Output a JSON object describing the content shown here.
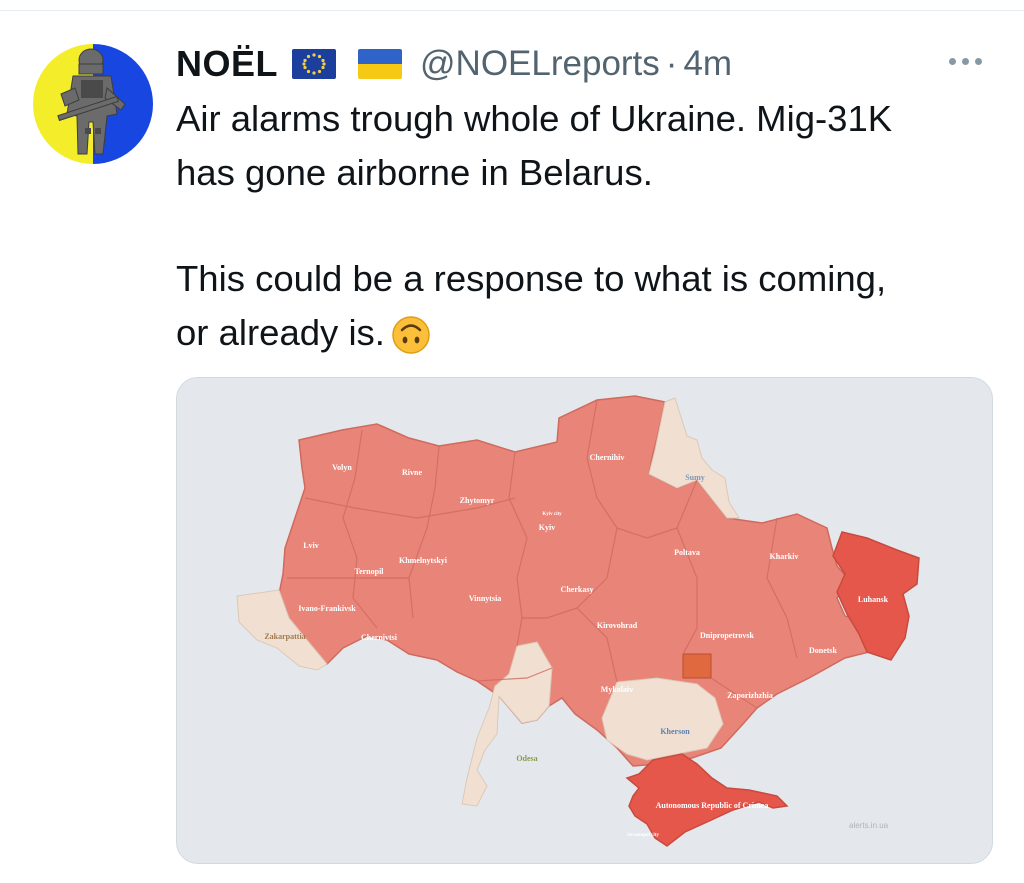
{
  "tweet": {
    "author_name": "NOËL",
    "author_flags": [
      "eu-flag-icon",
      "ukraine-flag-icon"
    ],
    "handle": "@NOELreports",
    "separator": "·",
    "time": "4m",
    "text_lines": [
      "Air alarms trough whole of Ukraine. Mig-31K",
      "has gone airborne in Belarus.",
      "This could be a response to what is coming,",
      "or already is."
    ],
    "emoji": "upside-down-face-icon"
  },
  "map": {
    "regions": {
      "volyn": "Volyn",
      "rivne": "Rivne",
      "zhytomyr": "Zhytomyr",
      "chernihiv": "Chernihiv",
      "sumy": "Sumy",
      "kyiv_city": "Kyiv city",
      "kyiv": "Kyiv",
      "lviv": "Lviv",
      "khmelnytskyi": "Khmelnytskyi",
      "ternopil": "Ternopil",
      "poltava": "Poltava",
      "kharkiv": "Kharkiv",
      "luhansk": "Luhansk",
      "ivano_frankivsk": "Ivano-Frankivsk",
      "vinnytsia": "Vinnytsia",
      "cherkasy": "Cherkasy",
      "zakarpattia": "Zakarpattia",
      "chernivtsi": "Chernivtsi",
      "kirovohrad": "Kirovohrad",
      "dnipropetrovsk": "Dnipropetrovsk",
      "donetsk": "Donetsk",
      "mykolaiv": "Mykolaiv",
      "zaporizhzhia": "Zaporizhzhia",
      "kherson": "Kherson",
      "odesa": "Odesa",
      "crimea": "Autonomous Republic of Crimea",
      "sevastopol": "Sevastopol city"
    },
    "watermark": "alerts.in.ua",
    "colors": {
      "alert": "#e98478",
      "alert_strong": "#e4574a",
      "no_alert": "#f1e0d2",
      "background": "#e4e8ec",
      "border": "#cf6a5e"
    }
  }
}
